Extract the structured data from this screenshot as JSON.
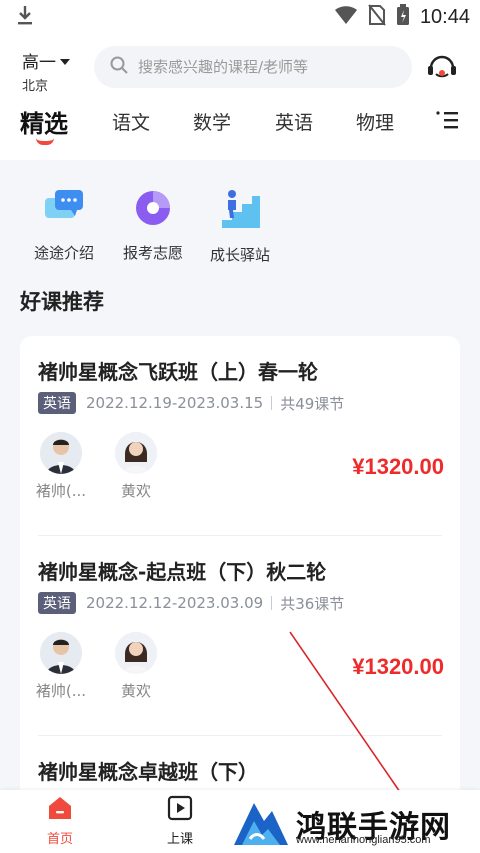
{
  "status_bar": {
    "time": "10:44",
    "icons": [
      "download-icon",
      "wifi-icon",
      "no-sim-icon",
      "battery-icon"
    ]
  },
  "header": {
    "grade": "高一",
    "city": "北京",
    "search_placeholder": "搜索感兴趣的课程/老师等",
    "support_icon": "customer-service-icon"
  },
  "tabs": [
    {
      "label": "精选",
      "active": true
    },
    {
      "label": "语文"
    },
    {
      "label": "数学"
    },
    {
      "label": "英语"
    },
    {
      "label": "物理"
    }
  ],
  "quick_links": [
    {
      "label": "途途介绍",
      "icon": "chat-bubble-icon"
    },
    {
      "label": "报考志愿",
      "icon": "target-icon"
    },
    {
      "label": "成长驿站",
      "icon": "stairs-climb-icon"
    }
  ],
  "section_title": "好课推荐",
  "courses": [
    {
      "title": "褚帅星概念飞跃班（上）春一轮",
      "subject": "英语",
      "dates": "2022.12.19-2023.03.15",
      "lessons": "共49课节",
      "teachers": [
        "褚帅(...",
        "黄欢"
      ],
      "price": "¥1320.00"
    },
    {
      "title": "褚帅星概念-起点班（下）秋二轮",
      "subject": "英语",
      "dates": "2022.12.12-2023.03.09",
      "lessons": "共36课节",
      "teachers": [
        "褚帅(...",
        "黄欢"
      ],
      "price": "¥1320.00"
    },
    {
      "title": "褚帅星概念卓越班（下）"
    }
  ],
  "bottom_nav": [
    {
      "label": "首页",
      "icon": "home-icon",
      "active": true
    },
    {
      "label": "上课",
      "icon": "play-icon"
    }
  ],
  "watermark": {
    "text": "鸿联手游网",
    "url": "www.henanhonglian95.com"
  },
  "colors": {
    "accent": "#f04a3c",
    "price": "#ee2b2b",
    "tag_bg": "#5b5f7a",
    "background": "#f4f6fa"
  }
}
